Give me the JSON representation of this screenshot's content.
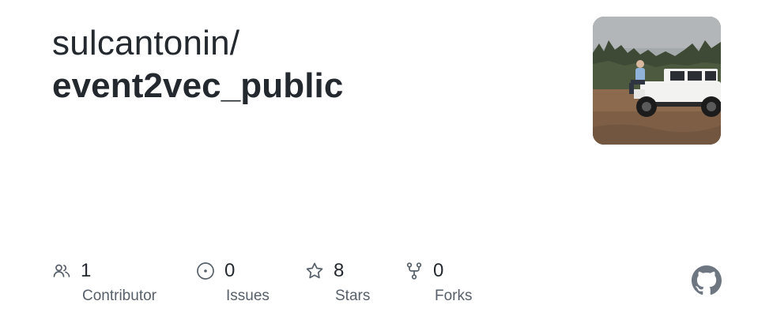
{
  "repo": {
    "owner": "sulcantonin/",
    "name": "event2vec_public"
  },
  "avatar": {
    "alt": "owner avatar photo"
  },
  "stats": [
    {
      "icon": "people-icon",
      "value": "1",
      "label": "Contributor"
    },
    {
      "icon": "issue-opened-icon",
      "value": "0",
      "label": "Issues"
    },
    {
      "icon": "star-icon",
      "value": "8",
      "label": "Stars"
    },
    {
      "icon": "repo-forked-icon",
      "value": "0",
      "label": "Forks"
    }
  ],
  "brand": {
    "icon": "github-mark-icon",
    "color": "#6e7681"
  },
  "colors": {
    "text": "#24292f",
    "muted": "#57606a"
  }
}
